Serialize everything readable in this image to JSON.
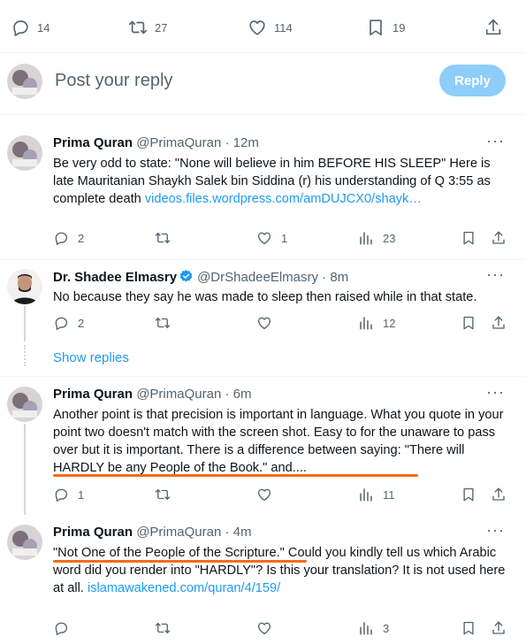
{
  "top_actions": {
    "replies": "14",
    "reposts": "27",
    "likes": "114",
    "bookmarks": "19"
  },
  "composer": {
    "placeholder": "Post your reply",
    "reply_label": "Reply"
  },
  "posts": [
    {
      "name": "Prima Quran",
      "handle": "@PrimaQuran",
      "time": "· 12m",
      "text": "Be very odd to state: \"None will believe in him BEFORE HIS SLEEP\"  Here is late Mauritanian Shaykh Salek bin Siddina (r) his understanding of Q 3:55 as complete death ",
      "link": "videos.files.wordpress.com/amDUJCX0/shayk…",
      "replies": "2",
      "reposts": "",
      "likes": "1",
      "views": "23"
    },
    {
      "name": "Dr. Shadee Elmasry",
      "handle": "@DrShadeeElmasry",
      "time": "· 8m",
      "text": "No because they say he was made to sleep then raised while in that state.",
      "replies": "2",
      "reposts": "",
      "likes": "",
      "views": "12"
    },
    {
      "name": "Prima Quran",
      "handle": "@PrimaQuran",
      "time": "· 6m",
      "text": "Another point is that precision is important in language.  What you quote in your point two doesn't match with the screen shot. Easy to for the unaware to pass over but it is important.  There is a difference between saying: \"There will HARDLY be any People of the Book.\" and....",
      "replies": "1",
      "reposts": "",
      "likes": "",
      "views": "11"
    },
    {
      "name": "Prima Quran",
      "handle": "@PrimaQuran",
      "time": "· 4m",
      "text": "\"Not One of the People of the Scripture.\"  Could you kindly tell us which Arabic word did you render into \"HARDLY\"? Is this your translation? It is not used here at all. ",
      "link": "islamawakened.com/quran/4/159/",
      "replies": "",
      "reposts": "",
      "likes": "",
      "views": "3"
    }
  ],
  "show_replies": "Show replies",
  "colors": {
    "accent": "#1d9bf0",
    "reply_button": "#8ecdf8",
    "annotation": "#f06d1b",
    "muted": "#536471"
  },
  "icons": [
    "reply-icon",
    "repost-icon",
    "like-icon",
    "bookmark-icon",
    "share-icon",
    "views-icon",
    "more-icon",
    "verified-badge-icon"
  ]
}
